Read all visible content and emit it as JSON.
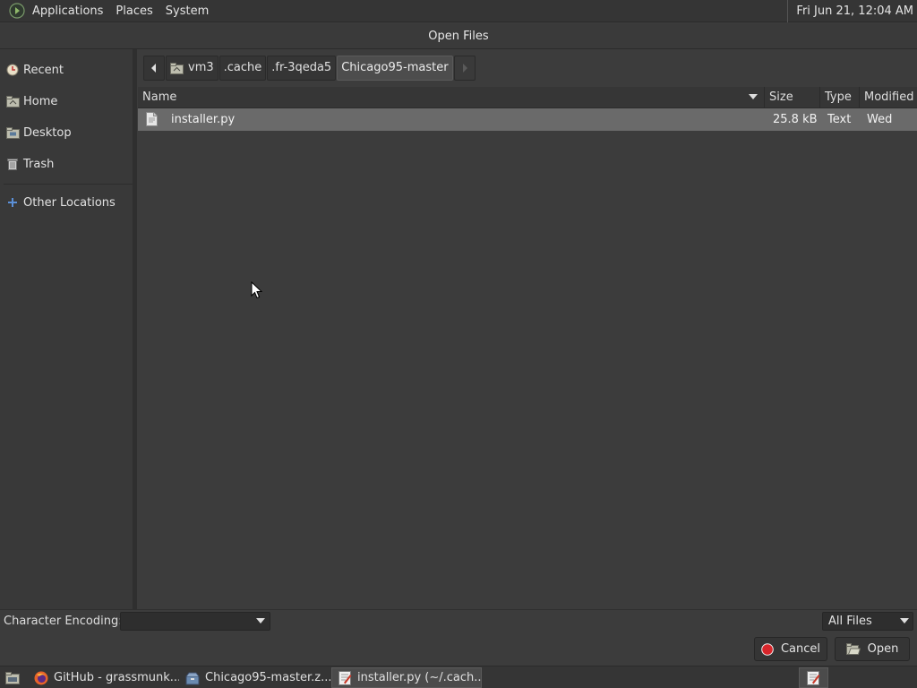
{
  "top_panel": {
    "menus": [
      "Applications",
      "Places",
      "System"
    ],
    "clock": "Fri Jun 21, 12:04 AM"
  },
  "window": {
    "title": "Open Files"
  },
  "sidebar": {
    "items": [
      {
        "label": "Recent",
        "icon": "recent-icon"
      },
      {
        "label": "Home",
        "icon": "home-folder-icon"
      },
      {
        "label": "Desktop",
        "icon": "desktop-folder-icon"
      },
      {
        "label": "Trash",
        "icon": "trash-icon"
      },
      {
        "label": "Other Locations",
        "icon": "plus-icon"
      }
    ]
  },
  "pathbar": {
    "crumbs": [
      "vm3",
      ".cache",
      ".fr-3qeda5",
      "Chicago95-master"
    ],
    "active": "Chicago95-master"
  },
  "file_list": {
    "columns": [
      "Name",
      "Size",
      "Type",
      "Modified"
    ],
    "rows": [
      {
        "name": "installer.py",
        "size": "25.8 kB",
        "type": "Text",
        "modified": "Wed",
        "selected": true
      }
    ]
  },
  "bottom": {
    "encoding_label": "Character Encoding:",
    "encoding_value": "",
    "filter_value": "All Files",
    "cancel_label": "Cancel",
    "open_label": "Open"
  },
  "taskbar": {
    "tasks": [
      {
        "label": "GitHub - grassmunk...",
        "icon": "firefox-icon"
      },
      {
        "label": "Chicago95-master.z...",
        "icon": "archive-manager-icon"
      },
      {
        "label": "installer.py (~/.cach...",
        "icon": "text-editor-icon",
        "active": true
      }
    ]
  },
  "colors": {
    "panel_bg": "#353535",
    "window_bg": "#3c3c3c",
    "selected_row": "#6a6a6a",
    "cancel_icon_red": "#d8262b"
  }
}
